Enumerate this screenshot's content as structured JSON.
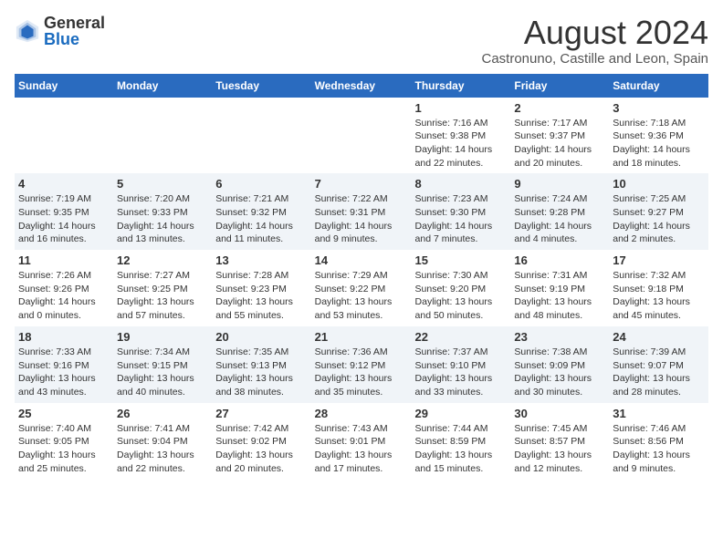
{
  "logo": {
    "general": "General",
    "blue": "Blue"
  },
  "title": "August 2024",
  "subtitle": "Castronuno, Castille and Leon, Spain",
  "weekdays": [
    "Sunday",
    "Monday",
    "Tuesday",
    "Wednesday",
    "Thursday",
    "Friday",
    "Saturday"
  ],
  "weeks": [
    [
      {
        "day": "",
        "info": ""
      },
      {
        "day": "",
        "info": ""
      },
      {
        "day": "",
        "info": ""
      },
      {
        "day": "",
        "info": ""
      },
      {
        "day": "1",
        "info": "Sunrise: 7:16 AM\nSunset: 9:38 PM\nDaylight: 14 hours\nand 22 minutes."
      },
      {
        "day": "2",
        "info": "Sunrise: 7:17 AM\nSunset: 9:37 PM\nDaylight: 14 hours\nand 20 minutes."
      },
      {
        "day": "3",
        "info": "Sunrise: 7:18 AM\nSunset: 9:36 PM\nDaylight: 14 hours\nand 18 minutes."
      }
    ],
    [
      {
        "day": "4",
        "info": "Sunrise: 7:19 AM\nSunset: 9:35 PM\nDaylight: 14 hours\nand 16 minutes."
      },
      {
        "day": "5",
        "info": "Sunrise: 7:20 AM\nSunset: 9:33 PM\nDaylight: 14 hours\nand 13 minutes."
      },
      {
        "day": "6",
        "info": "Sunrise: 7:21 AM\nSunset: 9:32 PM\nDaylight: 14 hours\nand 11 minutes."
      },
      {
        "day": "7",
        "info": "Sunrise: 7:22 AM\nSunset: 9:31 PM\nDaylight: 14 hours\nand 9 minutes."
      },
      {
        "day": "8",
        "info": "Sunrise: 7:23 AM\nSunset: 9:30 PM\nDaylight: 14 hours\nand 7 minutes."
      },
      {
        "day": "9",
        "info": "Sunrise: 7:24 AM\nSunset: 9:28 PM\nDaylight: 14 hours\nand 4 minutes."
      },
      {
        "day": "10",
        "info": "Sunrise: 7:25 AM\nSunset: 9:27 PM\nDaylight: 14 hours\nand 2 minutes."
      }
    ],
    [
      {
        "day": "11",
        "info": "Sunrise: 7:26 AM\nSunset: 9:26 PM\nDaylight: 14 hours\nand 0 minutes."
      },
      {
        "day": "12",
        "info": "Sunrise: 7:27 AM\nSunset: 9:25 PM\nDaylight: 13 hours\nand 57 minutes."
      },
      {
        "day": "13",
        "info": "Sunrise: 7:28 AM\nSunset: 9:23 PM\nDaylight: 13 hours\nand 55 minutes."
      },
      {
        "day": "14",
        "info": "Sunrise: 7:29 AM\nSunset: 9:22 PM\nDaylight: 13 hours\nand 53 minutes."
      },
      {
        "day": "15",
        "info": "Sunrise: 7:30 AM\nSunset: 9:20 PM\nDaylight: 13 hours\nand 50 minutes."
      },
      {
        "day": "16",
        "info": "Sunrise: 7:31 AM\nSunset: 9:19 PM\nDaylight: 13 hours\nand 48 minutes."
      },
      {
        "day": "17",
        "info": "Sunrise: 7:32 AM\nSunset: 9:18 PM\nDaylight: 13 hours\nand 45 minutes."
      }
    ],
    [
      {
        "day": "18",
        "info": "Sunrise: 7:33 AM\nSunset: 9:16 PM\nDaylight: 13 hours\nand 43 minutes."
      },
      {
        "day": "19",
        "info": "Sunrise: 7:34 AM\nSunset: 9:15 PM\nDaylight: 13 hours\nand 40 minutes."
      },
      {
        "day": "20",
        "info": "Sunrise: 7:35 AM\nSunset: 9:13 PM\nDaylight: 13 hours\nand 38 minutes."
      },
      {
        "day": "21",
        "info": "Sunrise: 7:36 AM\nSunset: 9:12 PM\nDaylight: 13 hours\nand 35 minutes."
      },
      {
        "day": "22",
        "info": "Sunrise: 7:37 AM\nSunset: 9:10 PM\nDaylight: 13 hours\nand 33 minutes."
      },
      {
        "day": "23",
        "info": "Sunrise: 7:38 AM\nSunset: 9:09 PM\nDaylight: 13 hours\nand 30 minutes."
      },
      {
        "day": "24",
        "info": "Sunrise: 7:39 AM\nSunset: 9:07 PM\nDaylight: 13 hours\nand 28 minutes."
      }
    ],
    [
      {
        "day": "25",
        "info": "Sunrise: 7:40 AM\nSunset: 9:05 PM\nDaylight: 13 hours\nand 25 minutes."
      },
      {
        "day": "26",
        "info": "Sunrise: 7:41 AM\nSunset: 9:04 PM\nDaylight: 13 hours\nand 22 minutes."
      },
      {
        "day": "27",
        "info": "Sunrise: 7:42 AM\nSunset: 9:02 PM\nDaylight: 13 hours\nand 20 minutes."
      },
      {
        "day": "28",
        "info": "Sunrise: 7:43 AM\nSunset: 9:01 PM\nDaylight: 13 hours\nand 17 minutes."
      },
      {
        "day": "29",
        "info": "Sunrise: 7:44 AM\nSunset: 8:59 PM\nDaylight: 13 hours\nand 15 minutes."
      },
      {
        "day": "30",
        "info": "Sunrise: 7:45 AM\nSunset: 8:57 PM\nDaylight: 13 hours\nand 12 minutes."
      },
      {
        "day": "31",
        "info": "Sunrise: 7:46 AM\nSunset: 8:56 PM\nDaylight: 13 hours\nand 9 minutes."
      }
    ]
  ]
}
